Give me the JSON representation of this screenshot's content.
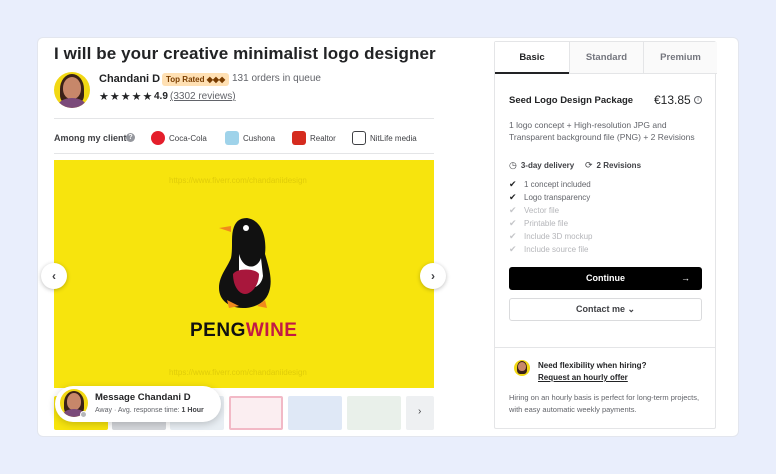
{
  "gig": {
    "title": "I will be your creative minimalist logo designer"
  },
  "seller": {
    "name": "Chandani D",
    "badge": "Top Rated ◆◆◆",
    "orders_in_queue": "131 orders in queue",
    "stars": "★★★★★",
    "rating": "4.9",
    "reviews": "(3302 reviews)"
  },
  "clients": {
    "label": "Among my clients",
    "items": [
      {
        "name": "Coca-Cola",
        "color": "#e41e2b"
      },
      {
        "name": "Cushona",
        "color": "#9fd3ea"
      },
      {
        "name": "Realtor",
        "color": "#d52b1e"
      },
      {
        "name": "NitLife media",
        "color": "#404145"
      }
    ]
  },
  "gallery": {
    "watermark": "https://www.fiverr.com/chandaniidesign",
    "brand_part_a": "PENG",
    "brand_part_b": "WINE",
    "prev_icon": "‹",
    "next_icon": "›"
  },
  "message_card": {
    "title": "Message Chandani D",
    "status": "Away",
    "response_label": "Avg. response time:",
    "response_value": "1 Hour"
  },
  "packages": {
    "tabs": [
      "Basic",
      "Standard",
      "Premium"
    ],
    "active_tab": "Basic",
    "name": "Seed Logo Design Package",
    "price": "€13.85",
    "description": "1 logo concept + High-resolution JPG and Transparent background file (PNG) + 2 Revisions",
    "delivery": "3-day delivery",
    "revisions": "2 Revisions",
    "features": [
      {
        "label": "1 concept included",
        "included": true
      },
      {
        "label": "Logo transparency",
        "included": true
      },
      {
        "label": "Vector file",
        "included": false
      },
      {
        "label": "Printable file",
        "included": false
      },
      {
        "label": "Include 3D mockup",
        "included": false
      },
      {
        "label": "Include source file",
        "included": false
      }
    ],
    "continue_label": "Continue",
    "contact_label": "Contact me ⌄"
  },
  "hourly": {
    "question": "Need flexibility when hiring?",
    "link": "Request an hourly offer",
    "description": "Hiring on an hourly basis is perfect for long-term projects, with easy automatic weekly payments."
  }
}
